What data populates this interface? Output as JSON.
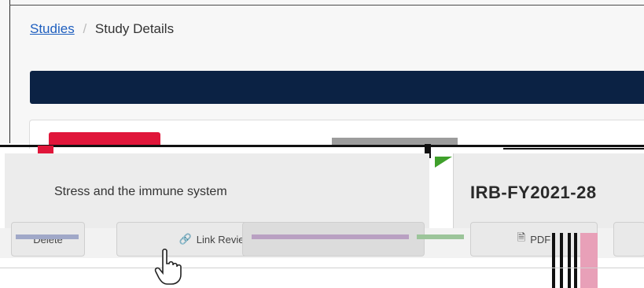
{
  "breadcrumb": {
    "root_label": "Studies",
    "separator": "/",
    "current_label": "Study Details"
  },
  "study": {
    "title": "Stress and the immune system",
    "irb_number": "IRB-FY2021-28"
  },
  "actions": {
    "delete_label": "Delete",
    "link_label": "Link Reviews",
    "pdf_label": "PDF"
  },
  "colors": {
    "navy": "#0b2244",
    "red_accent": "#e0163a",
    "green_flag": "#3fa02b",
    "link_blue": "#1f5fbf"
  },
  "icons": {
    "pdf": "document-icon",
    "cursor": "hand-pointer-icon"
  }
}
